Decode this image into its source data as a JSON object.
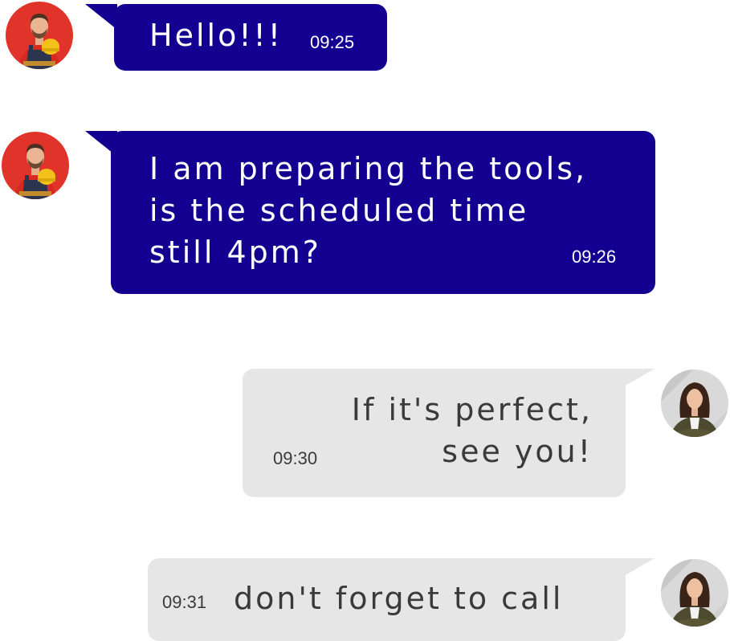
{
  "colors": {
    "outgoing_bubble": "#130090",
    "incoming_bubble": "#e6e6e6",
    "outgoing_text": "#ffffff",
    "incoming_text": "#3a3a3a",
    "worker_avatar_bg": "#e0342a",
    "woman_avatar_bg": "#d9d9d9"
  },
  "messages": [
    {
      "sender": "worker",
      "avatar_icon": "worker-avatar-icon",
      "text": "Hello!!!",
      "time": "09:25"
    },
    {
      "sender": "worker",
      "avatar_icon": "worker-avatar-icon",
      "text": "I am preparing the tools,\nis the scheduled time\nstill 4pm?",
      "time": "09:26"
    },
    {
      "sender": "woman",
      "avatar_icon": "woman-avatar-icon",
      "text": "If it's perfect,\nsee you!",
      "time": "09:30"
    },
    {
      "sender": "woman",
      "avatar_icon": "woman-avatar-icon",
      "text": "don't forget to call",
      "time": "09:31"
    }
  ]
}
